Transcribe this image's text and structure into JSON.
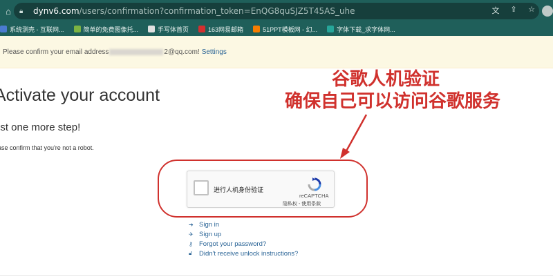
{
  "browser": {
    "url_host": "dynv6.com",
    "url_path": "/users/confirmation?confirmation_token=EnQG8quSJZ5T45AS_uhe",
    "bookmarks": [
      {
        "label": "系统测壳 - 互联网...",
        "color": "#4a7bd0"
      },
      {
        "label": "简单的免费图像托...",
        "color": "#7cb342"
      },
      {
        "label": "手写体首页",
        "color": "#e0e0e0"
      },
      {
        "label": "163网易邮箱",
        "color": "#d32f2f"
      },
      {
        "label": "51PPT模板网 - 幻...",
        "color": "#f57c00"
      },
      {
        "label": "字体下载_求字体网...",
        "color": "#26a69a"
      }
    ]
  },
  "flash": {
    "prefix": "Please confirm your email address",
    "suffix": "2@qq.com!",
    "link": "Settings"
  },
  "page": {
    "title": "Activate your account",
    "subtitle": "ust one more step!",
    "description": "ease confirm that you're not a robot."
  },
  "captcha": {
    "label": "进行人机身份验证",
    "brand": "reCAPTCHA",
    "terms": "隐私权 - 使用条款"
  },
  "annotation": {
    "line1": "谷歌人机验证",
    "line2": "确保自己可以访问谷歌服务",
    "color": "#d0312d"
  },
  "links": [
    {
      "icon": "sign-in-icon",
      "glyph": "➔",
      "label": "Sign in"
    },
    {
      "icon": "rocket-icon",
      "glyph": "✈",
      "label": "Sign up"
    },
    {
      "icon": "key-icon",
      "glyph": "⚷",
      "label": "Forgot your password?"
    },
    {
      "icon": "unlock-icon",
      "glyph": "🔓︎",
      "label": "Didn't receive unlock instructions?"
    }
  ]
}
